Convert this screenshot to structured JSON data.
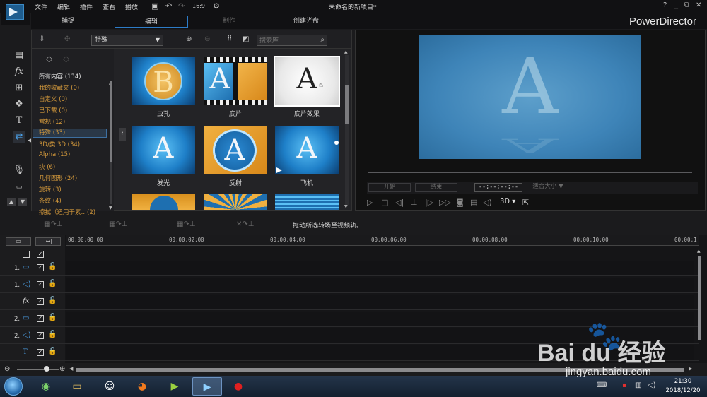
{
  "menu": {
    "items": [
      "文件",
      "编辑",
      "插件",
      "查看",
      "播放"
    ],
    "project_title": "未命名的新项目*",
    "window_controls": [
      "?",
      "_",
      "⧉",
      "✕"
    ]
  },
  "modes": {
    "tabs": [
      {
        "label": "捕捉",
        "state": "normal"
      },
      {
        "label": "编辑",
        "state": "active"
      },
      {
        "label": "制作",
        "state": "disabled"
      },
      {
        "label": "创建光盘",
        "state": "normal"
      }
    ],
    "brand": "PowerDirector"
  },
  "library": {
    "category_select": "特殊",
    "search_placeholder": "搜索库",
    "categories": [
      {
        "label": "所有内容 (134)",
        "style": "white"
      },
      {
        "label": "我的收藏夹 (0)",
        "style": "orange"
      },
      {
        "label": "自定义 (0)",
        "style": "orange"
      },
      {
        "label": "已下载 (0)",
        "style": "orange"
      },
      {
        "label": "常规 (12)",
        "style": "orange"
      },
      {
        "label": "特殊 (33)",
        "style": "selected"
      },
      {
        "label": "3D/类 3D (34)",
        "style": "orange"
      },
      {
        "label": "Alpha (15)",
        "style": "orange"
      },
      {
        "label": "块 (6)",
        "style": "orange"
      },
      {
        "label": "几何图形 (24)",
        "style": "orange"
      },
      {
        "label": "旋转 (3)",
        "style": "orange"
      },
      {
        "label": "条纹 (4)",
        "style": "orange"
      },
      {
        "label": "擦拭（适用于素…(2)",
        "style": "orange"
      }
    ],
    "thumbnails": [
      {
        "label": "虫孔",
        "letter": "B"
      },
      {
        "label": "底片",
        "letter": "A"
      },
      {
        "label": "底片效果",
        "letter": "A",
        "selected": true
      },
      {
        "label": "发光",
        "letter": "A"
      },
      {
        "label": "反射",
        "letter": "A"
      },
      {
        "label": "飞机",
        "letter": "A"
      }
    ]
  },
  "preview": {
    "letter": "A",
    "btn_start": "开始",
    "btn_end": "结束",
    "timecode": "--;--;--;--",
    "fit_label": "适合大小",
    "mode_3d": "3D"
  },
  "timeline": {
    "hint": "拖动所选转场至视频轨。",
    "ruler": [
      "00;00;00;00",
      "00;00;02;00",
      "00;00;04;00",
      "00;00;06;00",
      "00;00;08;00",
      "00;00;10;00",
      "00;00;1"
    ],
    "tracks": [
      {
        "num": "1.",
        "icon": "video-track-icon",
        "glyph": "▭"
      },
      {
        "num": "1.",
        "icon": "audio-track-icon",
        "glyph": "◁)"
      },
      {
        "num": "",
        "icon": "fx-track-icon",
        "glyph": "fx"
      },
      {
        "num": "2.",
        "icon": "video-track-icon",
        "glyph": "▭"
      },
      {
        "num": "2.",
        "icon": "audio-track-icon",
        "glyph": "◁)"
      },
      {
        "num": "",
        "icon": "title-track-icon",
        "glyph": "T"
      }
    ]
  },
  "taskbar": {
    "time": "21:30",
    "date": "2018/12/20"
  },
  "watermark": {
    "brand": "Bai du 经验",
    "url": "jingyan.baidu.com"
  }
}
